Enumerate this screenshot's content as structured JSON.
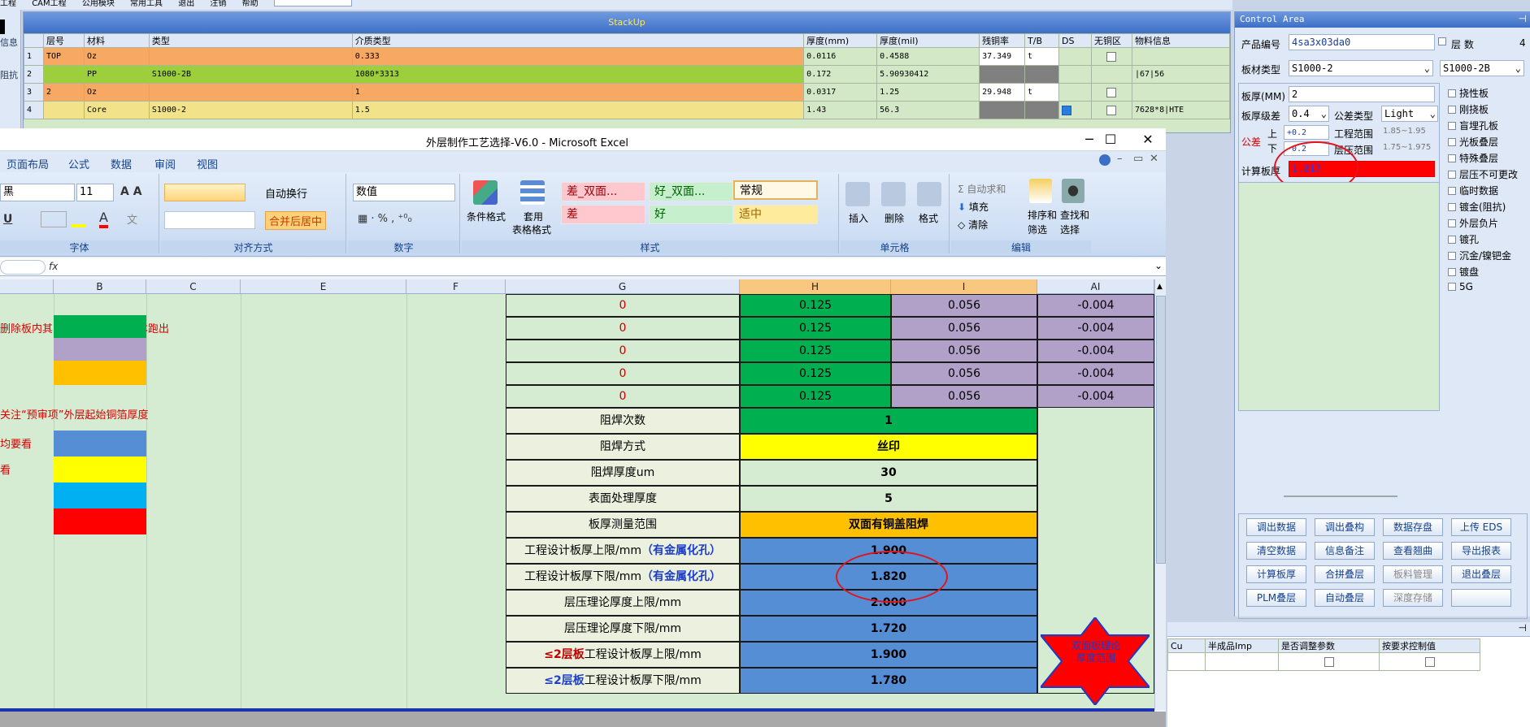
{
  "top_menu": [
    "工程",
    "CAM工程",
    "公用模块",
    "常用工具",
    "退出",
    "注销",
    "帮助"
  ],
  "left_strip": {
    "info": "信息",
    "imp": "阻抗"
  },
  "stackup": {
    "title": "StackUp",
    "headers": [
      "层号",
      "材料",
      "类型",
      "介质类型",
      "厚度(mm)",
      "厚度(mil)",
      "残铜率",
      "T/B",
      "DS",
      "无铜区",
      "物料信息"
    ],
    "rows": [
      {
        "no": "1",
        "layer": "TOP",
        "mat": "Oz",
        "type": "",
        "dielec": "0.333",
        "mm": "0.0116",
        "mil": "0.4588",
        "cu": "37.349",
        "tb": "t",
        "info": "",
        "color": "#f7a862"
      },
      {
        "no": "2",
        "layer": "",
        "mat": "PP",
        "type": "S1000-2B",
        "dielec": "1080*3313",
        "mm": "0.172",
        "mil": "5.90930412",
        "cu": "",
        "tb": "",
        "info": "|67|56",
        "color": "#9dcf3d"
      },
      {
        "no": "3",
        "layer": "2",
        "mat": "Oz",
        "type": "",
        "dielec": "1",
        "mm": "0.0317",
        "mil": "1.25",
        "cu": "29.948",
        "tb": "t",
        "info": "",
        "color": "#f7a862"
      },
      {
        "no": "4",
        "layer": "",
        "mat": "Core",
        "type": "S1000-2",
        "dielec": "1.5",
        "mm": "1.43",
        "mil": "56.3",
        "cu": "",
        "tb": "",
        "info": "7628*8|HTE",
        "color": "#f2e28a"
      }
    ]
  },
  "excel": {
    "title": "外层制作工艺选择-V6.0 - Microsoft Excel",
    "tabs": [
      "页面布局",
      "公式",
      "数据",
      "审阅",
      "视图"
    ],
    "font_name": "黑",
    "font_size": "11",
    "wrap_text": "自动换行",
    "merge_center": "合并后居中",
    "number_format": "数值",
    "styles": {
      "bad_double": "差_双面...",
      "good_double": "好_双面...",
      "normal": "常规",
      "bad": "差",
      "good": "好",
      "neutral": "适中"
    },
    "ribbon_buttons": {
      "cond_format": "条件格式",
      "table_format_1": "套用",
      "table_format_2": "表格格式",
      "insert": "插入",
      "delete": "删除",
      "format": "格式",
      "autosum": "自动求和",
      "fill": "填充",
      "clear": "清除",
      "sort_1": "排序和",
      "sort_2": "筛选",
      "find_1": "查找和",
      "find_2": "选择"
    },
    "groups": [
      "字体",
      "对齐方式",
      "数字",
      "样式",
      "单元格",
      "编辑"
    ],
    "fx": "fx",
    "columns": [
      "B",
      "C",
      "E",
      "F",
      "G",
      "H",
      "I",
      "AI"
    ],
    "notes": [
      "删除板内其它孔，预审采用脚本跑出",
      "关注“预审项”外层起始铜箔厚度",
      "均要看",
      "看"
    ],
    "top_rows": [
      {
        "g": "0",
        "h": "0.125",
        "i": "0.056",
        "ai": "-0.004"
      },
      {
        "g": "0",
        "h": "0.125",
        "i": "0.056",
        "ai": "-0.004"
      },
      {
        "g": "0",
        "h": "0.125",
        "i": "0.056",
        "ai": "-0.004"
      },
      {
        "g": "0",
        "h": "0.125",
        "i": "0.056",
        "ai": "-0.004"
      },
      {
        "g": "0",
        "h": "0.125",
        "i": "0.056",
        "ai": "-0.004"
      }
    ],
    "params": [
      {
        "label": "阻焊次数",
        "value": "1",
        "bg": "#00b050"
      },
      {
        "label": "阻焊方式",
        "value": "丝印",
        "bg": "#ffff00"
      },
      {
        "label": "阻焊厚度um",
        "value": "30",
        "bg": "#d6ecd2"
      },
      {
        "label": "表面处理厚度",
        "value": "5",
        "bg": "#d6ecd2"
      },
      {
        "label": "板厚测量范围",
        "value": "双面有铜盖阻焊",
        "bg": "#ffc000"
      }
    ],
    "limits": [
      {
        "pre": "",
        "label": "工程设计板厚上限/mm",
        "suffix": "（有金属化孔）",
        "value": "1.900"
      },
      {
        "pre": "",
        "label": "工程设计板厚下限/mm",
        "suffix": "（有金属化孔）",
        "value": "1.820"
      },
      {
        "pre": "",
        "label": "层压理论厚度上限/mm",
        "suffix": "",
        "value": "2.000"
      },
      {
        "pre": "",
        "label": "层压理论厚度下限/mm",
        "suffix": "",
        "value": "1.720"
      },
      {
        "pre": "≤2层板",
        "label": "工程设计板厚上限/mm",
        "suffix": "",
        "value": "1.900",
        "pre_color": "#c00000"
      },
      {
        "pre": "≤2层板",
        "label": "工程设计板厚下限/mm",
        "suffix": "",
        "value": "1.780",
        "pre_color": "#1f3fc8"
      }
    ],
    "star_text": "双面板理论厚度范围"
  },
  "control": {
    "title": "Control Area",
    "product_label": "产品编号",
    "product_value": "4sa3x03da0",
    "layers_label": "层 数",
    "layers_value": "4",
    "mat_label": "板材类型",
    "mat_value": "S1000-2",
    "mat_value2": "S1000-2B",
    "thk_label": "板厚(MM)",
    "thk_value": "2",
    "tol_label": "板厚级差",
    "tol_value": "0.4",
    "tol_type_label": "公差类型",
    "tol_type_value": "Light",
    "tol_side": "公差",
    "upper": "上",
    "lower": "下",
    "upper_val": "+0.2",
    "lower_val": "-0.2",
    "eng_range_label": "工程范围",
    "eng_range": "1.85~1.95",
    "press_range_label": "层压范围",
    "press_range": "1.75~1.975",
    "calc_label": "计算板厚",
    "calc_value": "1.817",
    "checks": [
      "挠性板",
      "刚挠板",
      "盲埋孔板",
      "光板叠层",
      "特殊叠层",
      "层压不可更改",
      "临时数据",
      "镀金(阻抗)",
      "外层负片",
      "镀孔",
      "沉金/镍钯金",
      "镀盘",
      "5G"
    ],
    "buttons": [
      [
        "调出数据",
        "调出叠构",
        "数据存盘",
        "上传 EDS"
      ],
      [
        "清空数据",
        "信息备注",
        "查看翘曲",
        "导出报表"
      ],
      [
        "计算板厚",
        "合拼叠层",
        "板料管理",
        "退出叠层"
      ],
      [
        "PLM叠层",
        "自动叠层",
        "深度存储",
        ""
      ]
    ]
  },
  "bottom_grid": {
    "headers": [
      "Cu",
      "半成品Imp",
      "是否调整参数",
      "按要求控制值"
    ]
  }
}
